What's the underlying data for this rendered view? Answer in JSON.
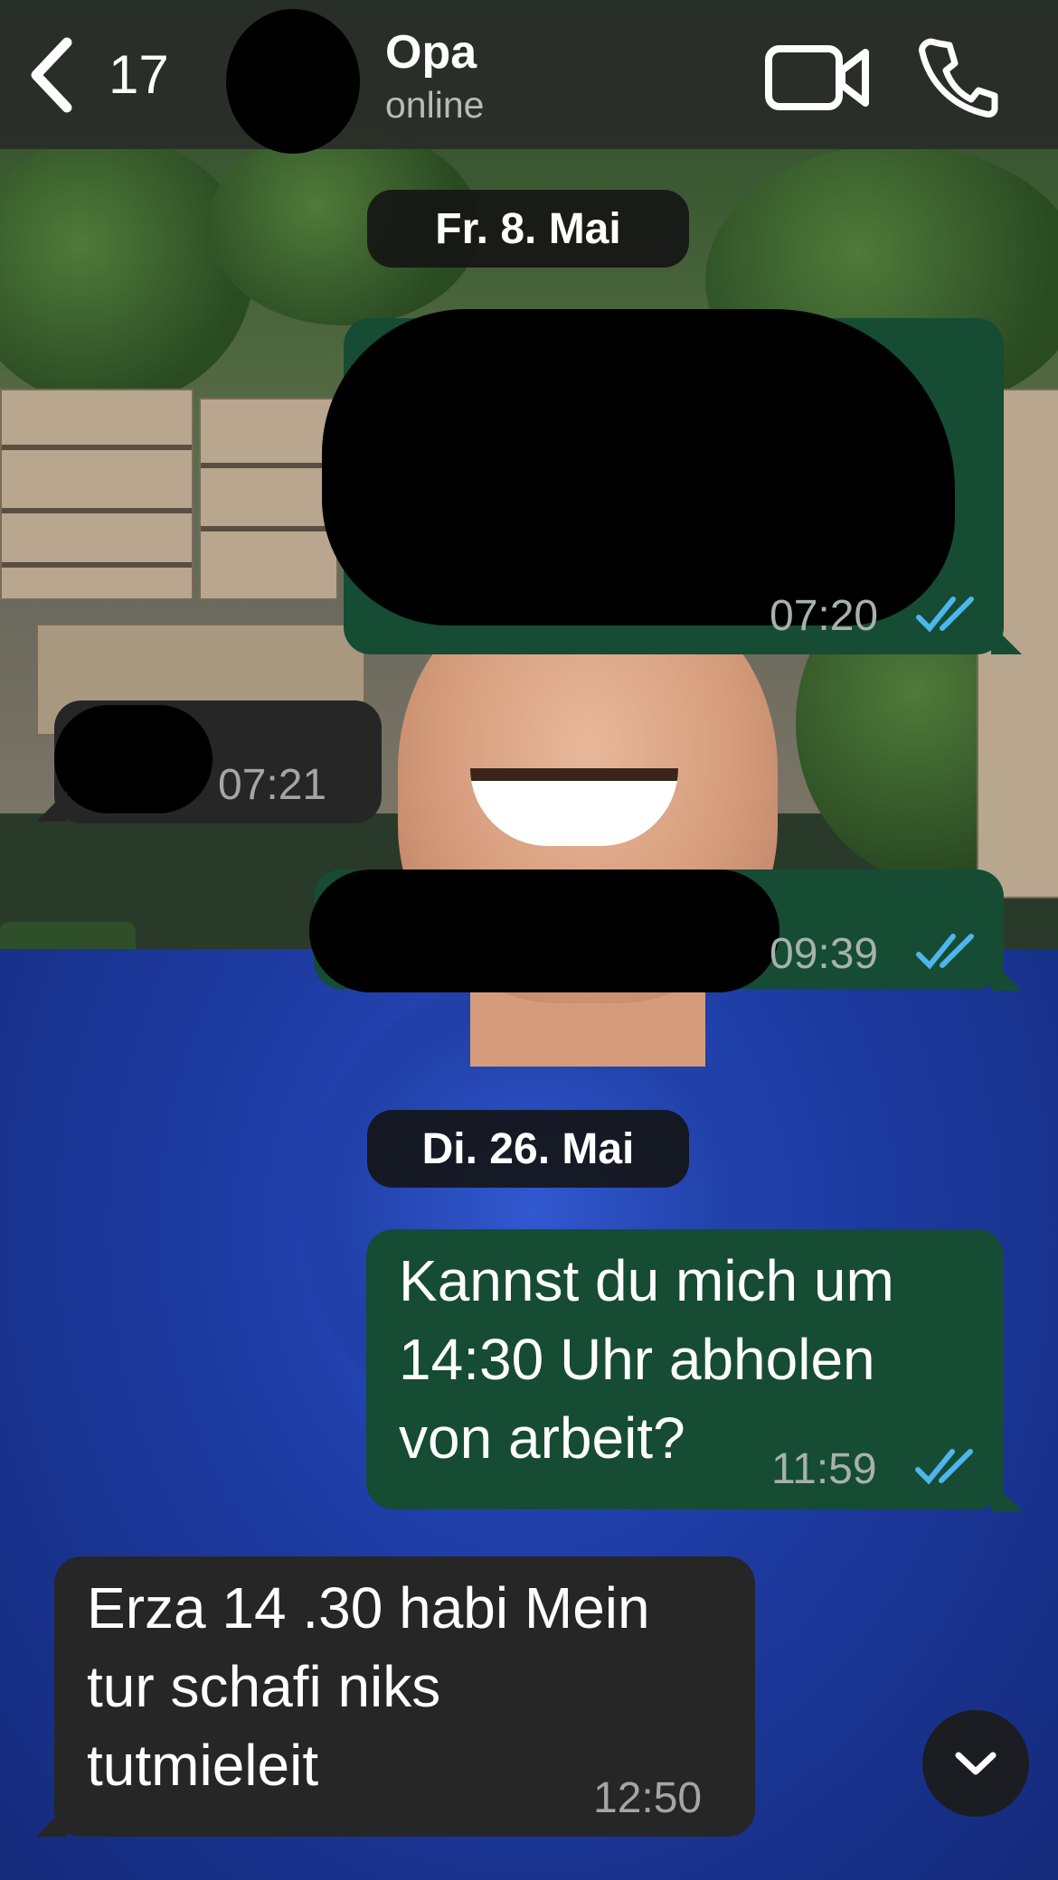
{
  "header": {
    "back_count": "17",
    "contact_name": "Opa",
    "contact_status": "online",
    "icons": [
      "chevron-left-icon",
      "video-camera-icon",
      "phone-icon"
    ]
  },
  "dates": [
    "Fr. 8. Mai",
    "Di. 26. Mai"
  ],
  "messages": [
    {
      "direction": "outgoing",
      "text": "",
      "redacted": true,
      "time": "07:20",
      "read": true
    },
    {
      "direction": "incoming",
      "text": "",
      "redacted": true,
      "time": "07:21"
    },
    {
      "direction": "outgoing",
      "text": "",
      "redacted": true,
      "time": "09:39",
      "read": true
    },
    {
      "direction": "outgoing",
      "lines": [
        "Kannst du mich um",
        "14:30 Uhr abholen",
        "von arbeit?"
      ],
      "time": "11:59",
      "read": true
    },
    {
      "direction": "incoming",
      "lines": [
        "Erza 14 .30 habi Mein",
        "tur schafi niks",
        "tutmieleit"
      ],
      "time": "12:50"
    }
  ],
  "colors": {
    "outgoing_bubble": "#164b34",
    "incoming_bubble": "#262626",
    "read_ticks": "#4fb6ec"
  }
}
